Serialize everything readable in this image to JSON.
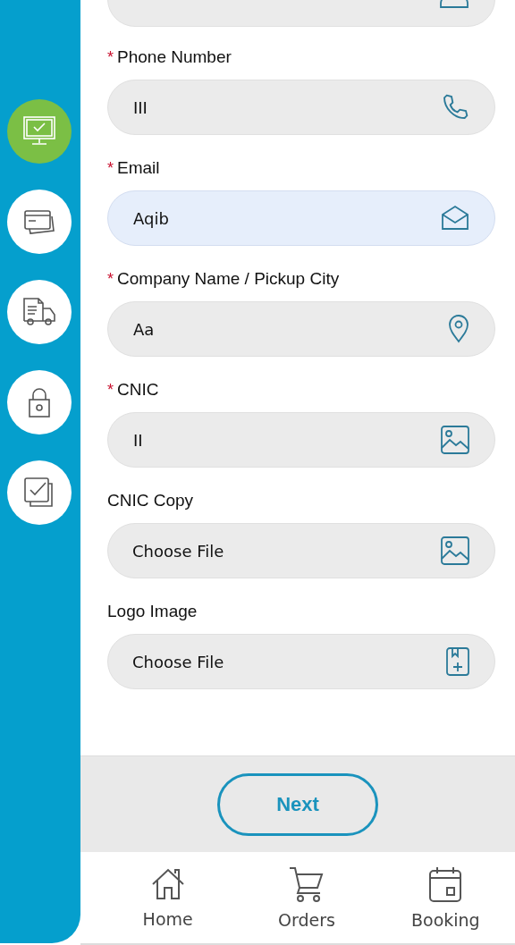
{
  "sidebar": {
    "items": [
      {
        "selected": true
      },
      {
        "selected": false
      },
      {
        "selected": false
      },
      {
        "selected": false
      },
      {
        "selected": false
      }
    ]
  },
  "form": {
    "fields": [
      {
        "kind": "text",
        "focused": false
      },
      {
        "kind": "text",
        "label": "Phone Number",
        "required": true,
        "value": "III",
        "focused": false
      },
      {
        "kind": "text",
        "label": "Email",
        "required": true,
        "value": "Aqib",
        "focused": true
      },
      {
        "kind": "text",
        "label": "Company Name / Pickup City",
        "required": true,
        "value": "Aa",
        "focused": false
      },
      {
        "kind": "text",
        "label": "CNIC",
        "required": true,
        "value": "II",
        "focused": false
      },
      {
        "kind": "file",
        "label": "CNIC Copy",
        "required": false,
        "value": "Choose File",
        "focused": false
      },
      {
        "kind": "file",
        "label": "Logo Image",
        "required": false,
        "value": "Choose File",
        "focused": false
      }
    ]
  },
  "required_mark": "*",
  "next_button": "Next",
  "bottom_nav": [
    {
      "label": "Home"
    },
    {
      "label": "Orders"
    },
    {
      "label": "Booking"
    }
  ]
}
